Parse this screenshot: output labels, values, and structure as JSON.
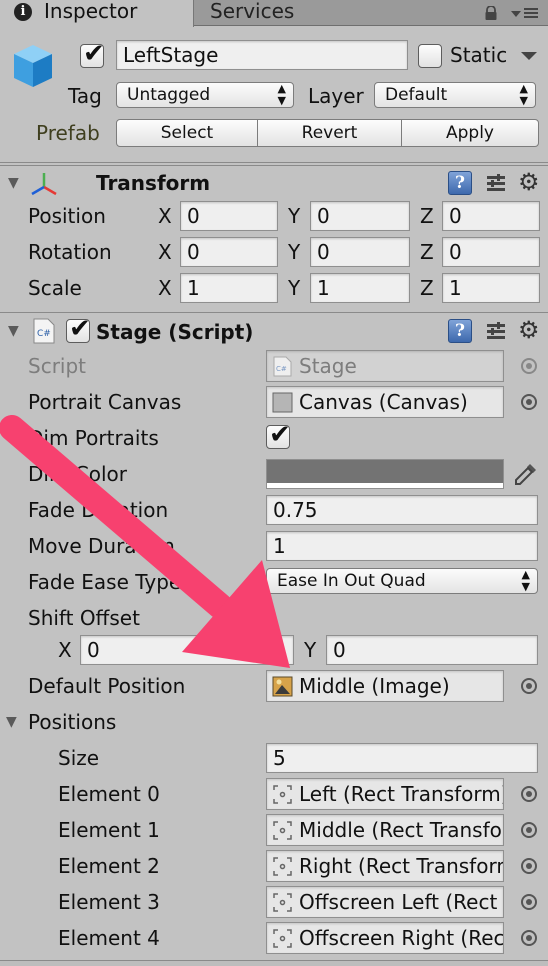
{
  "tabs": {
    "inspector": "Inspector",
    "services": "Services"
  },
  "header": {
    "object_name": "LeftStage",
    "active_checked": true,
    "static_label": "Static",
    "tag_label": "Tag",
    "tag_value": "Untagged",
    "layer_label": "Layer",
    "layer_value": "Default",
    "prefab_label": "Prefab",
    "prefab_buttons": [
      "Select",
      "Revert",
      "Apply"
    ]
  },
  "transform": {
    "title": "Transform",
    "rows": [
      {
        "label": "Position",
        "x": "0",
        "y": "0",
        "z": "0"
      },
      {
        "label": "Rotation",
        "x": "0",
        "y": "0",
        "z": "0"
      },
      {
        "label": "Scale",
        "x": "1",
        "y": "1",
        "z": "1"
      }
    ],
    "axes": [
      "X",
      "Y",
      "Z"
    ]
  },
  "stage": {
    "title": "Stage (Script)",
    "enabled": true,
    "script_label": "Script",
    "script_value": "Stage",
    "portrait_canvas_label": "Portrait Canvas",
    "portrait_canvas_value": "Canvas (Canvas)",
    "dim_portraits_label": "Dim Portraits",
    "dim_portraits_checked": true,
    "dim_color_label": "Dim Color",
    "dim_color_value": "#737373",
    "fade_duration_label": "Fade Duration",
    "fade_duration_value": "0.75",
    "move_duration_label": "Move Duration",
    "move_duration_value": "1",
    "fade_ease_label": "Fade Ease Type",
    "fade_ease_value": "Ease In Out Quad",
    "shift_offset_label": "Shift Offset",
    "shift_x_label": "X",
    "shift_x_value": "0",
    "shift_y_label": "Y",
    "shift_y_value": "0",
    "default_position_label": "Default Position",
    "default_position_value": "Middle (Image)",
    "positions_label": "Positions",
    "size_label": "Size",
    "size_value": "5",
    "elements": [
      {
        "label": "Element 0",
        "value": "Left (Rect Transform)"
      },
      {
        "label": "Element 1",
        "value": "Middle (Rect Transform)"
      },
      {
        "label": "Element 2",
        "value": "Right (Rect Transform)"
      },
      {
        "label": "Element 3",
        "value": "Offscreen Left (Rect Transform)"
      },
      {
        "label": "Element 4",
        "value": "Offscreen Right (Rect Transform)"
      }
    ]
  },
  "overlay": {
    "arrow_color": "#f7416f"
  }
}
